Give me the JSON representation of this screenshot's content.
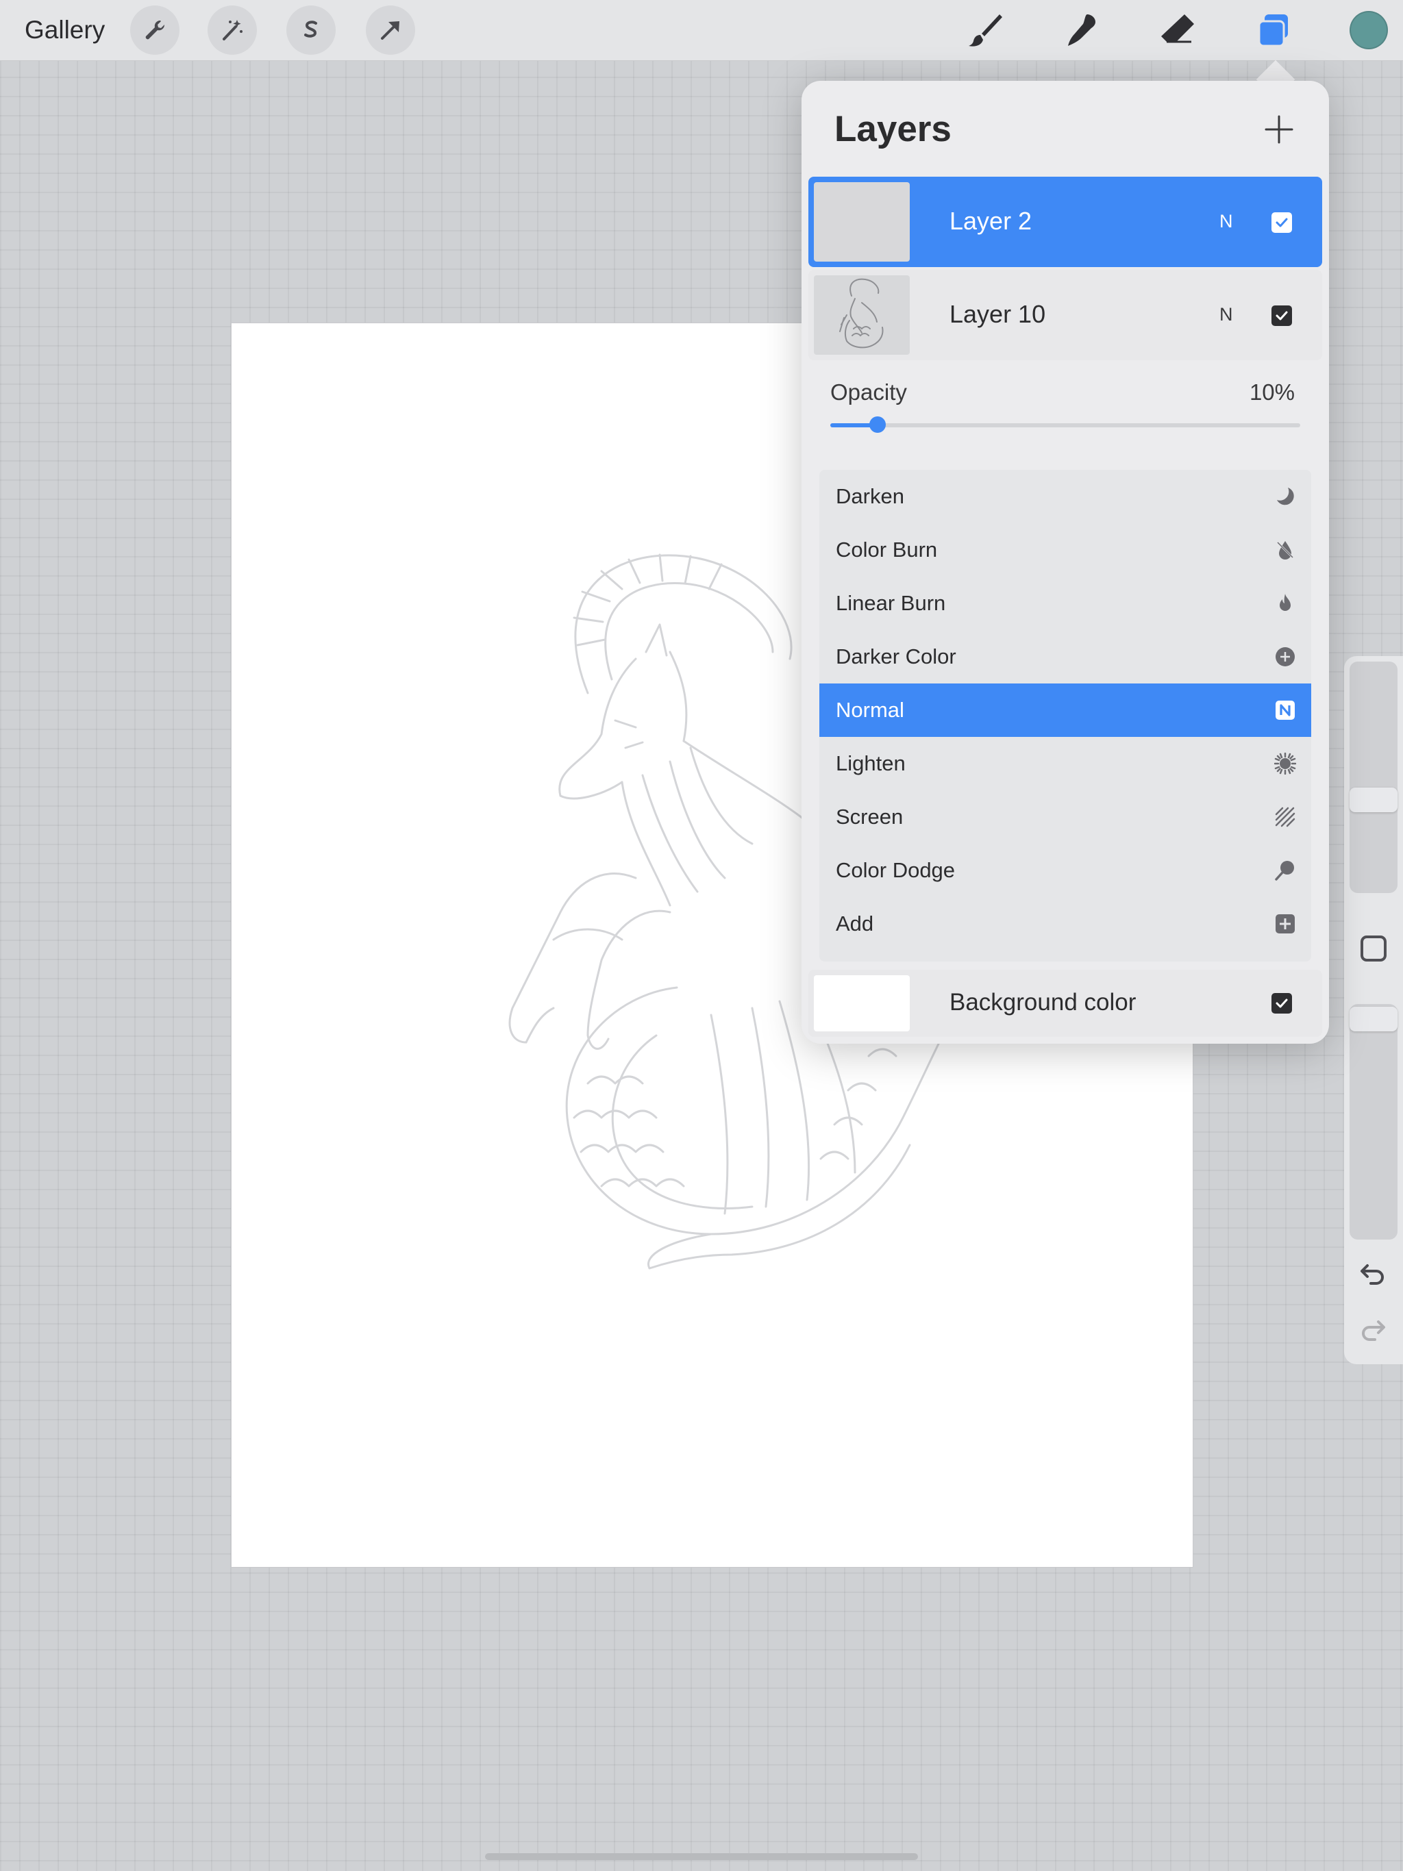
{
  "toolbar": {
    "gallery_label": "Gallery",
    "left_tools": [
      "wrench-icon",
      "magic-wand-icon",
      "selection-s-icon",
      "transform-arrow-icon"
    ],
    "right_tools": [
      "brush-icon",
      "smudge-icon",
      "eraser-icon",
      "layers-icon"
    ],
    "active_tool": "layers-icon",
    "current_color": "#5f9998"
  },
  "layers_panel": {
    "title": "Layers",
    "layers": [
      {
        "name": "Layer 2",
        "blend": "N",
        "visible": true,
        "active": true
      },
      {
        "name": "Layer 10",
        "blend": "N",
        "visible": true,
        "active": false
      }
    ],
    "opacity": {
      "label": "Opacity",
      "value": "10%",
      "fraction": 0.1
    },
    "blend_modes": [
      {
        "label": "Darken",
        "icon": "moon-icon"
      },
      {
        "label": "Color Burn",
        "icon": "burn-drop-icon"
      },
      {
        "label": "Linear Burn",
        "icon": "flame-icon"
      },
      {
        "label": "Darker Color",
        "icon": "plus-circle-icon"
      },
      {
        "label": "Normal",
        "icon": "n-square-icon",
        "selected": true
      },
      {
        "label": "Lighten",
        "icon": "sun-burst-icon"
      },
      {
        "label": "Screen",
        "icon": "hatch-square-icon"
      },
      {
        "label": "Color Dodge",
        "icon": "dodge-icon"
      },
      {
        "label": "Add",
        "icon": "plus-square-icon"
      }
    ],
    "background": {
      "label": "Background color",
      "visible": true,
      "color": "#ffffff"
    }
  },
  "colors": {
    "accent": "#3f89f5",
    "panel": "#ececee",
    "toolbar": "#e4e5e7"
  }
}
